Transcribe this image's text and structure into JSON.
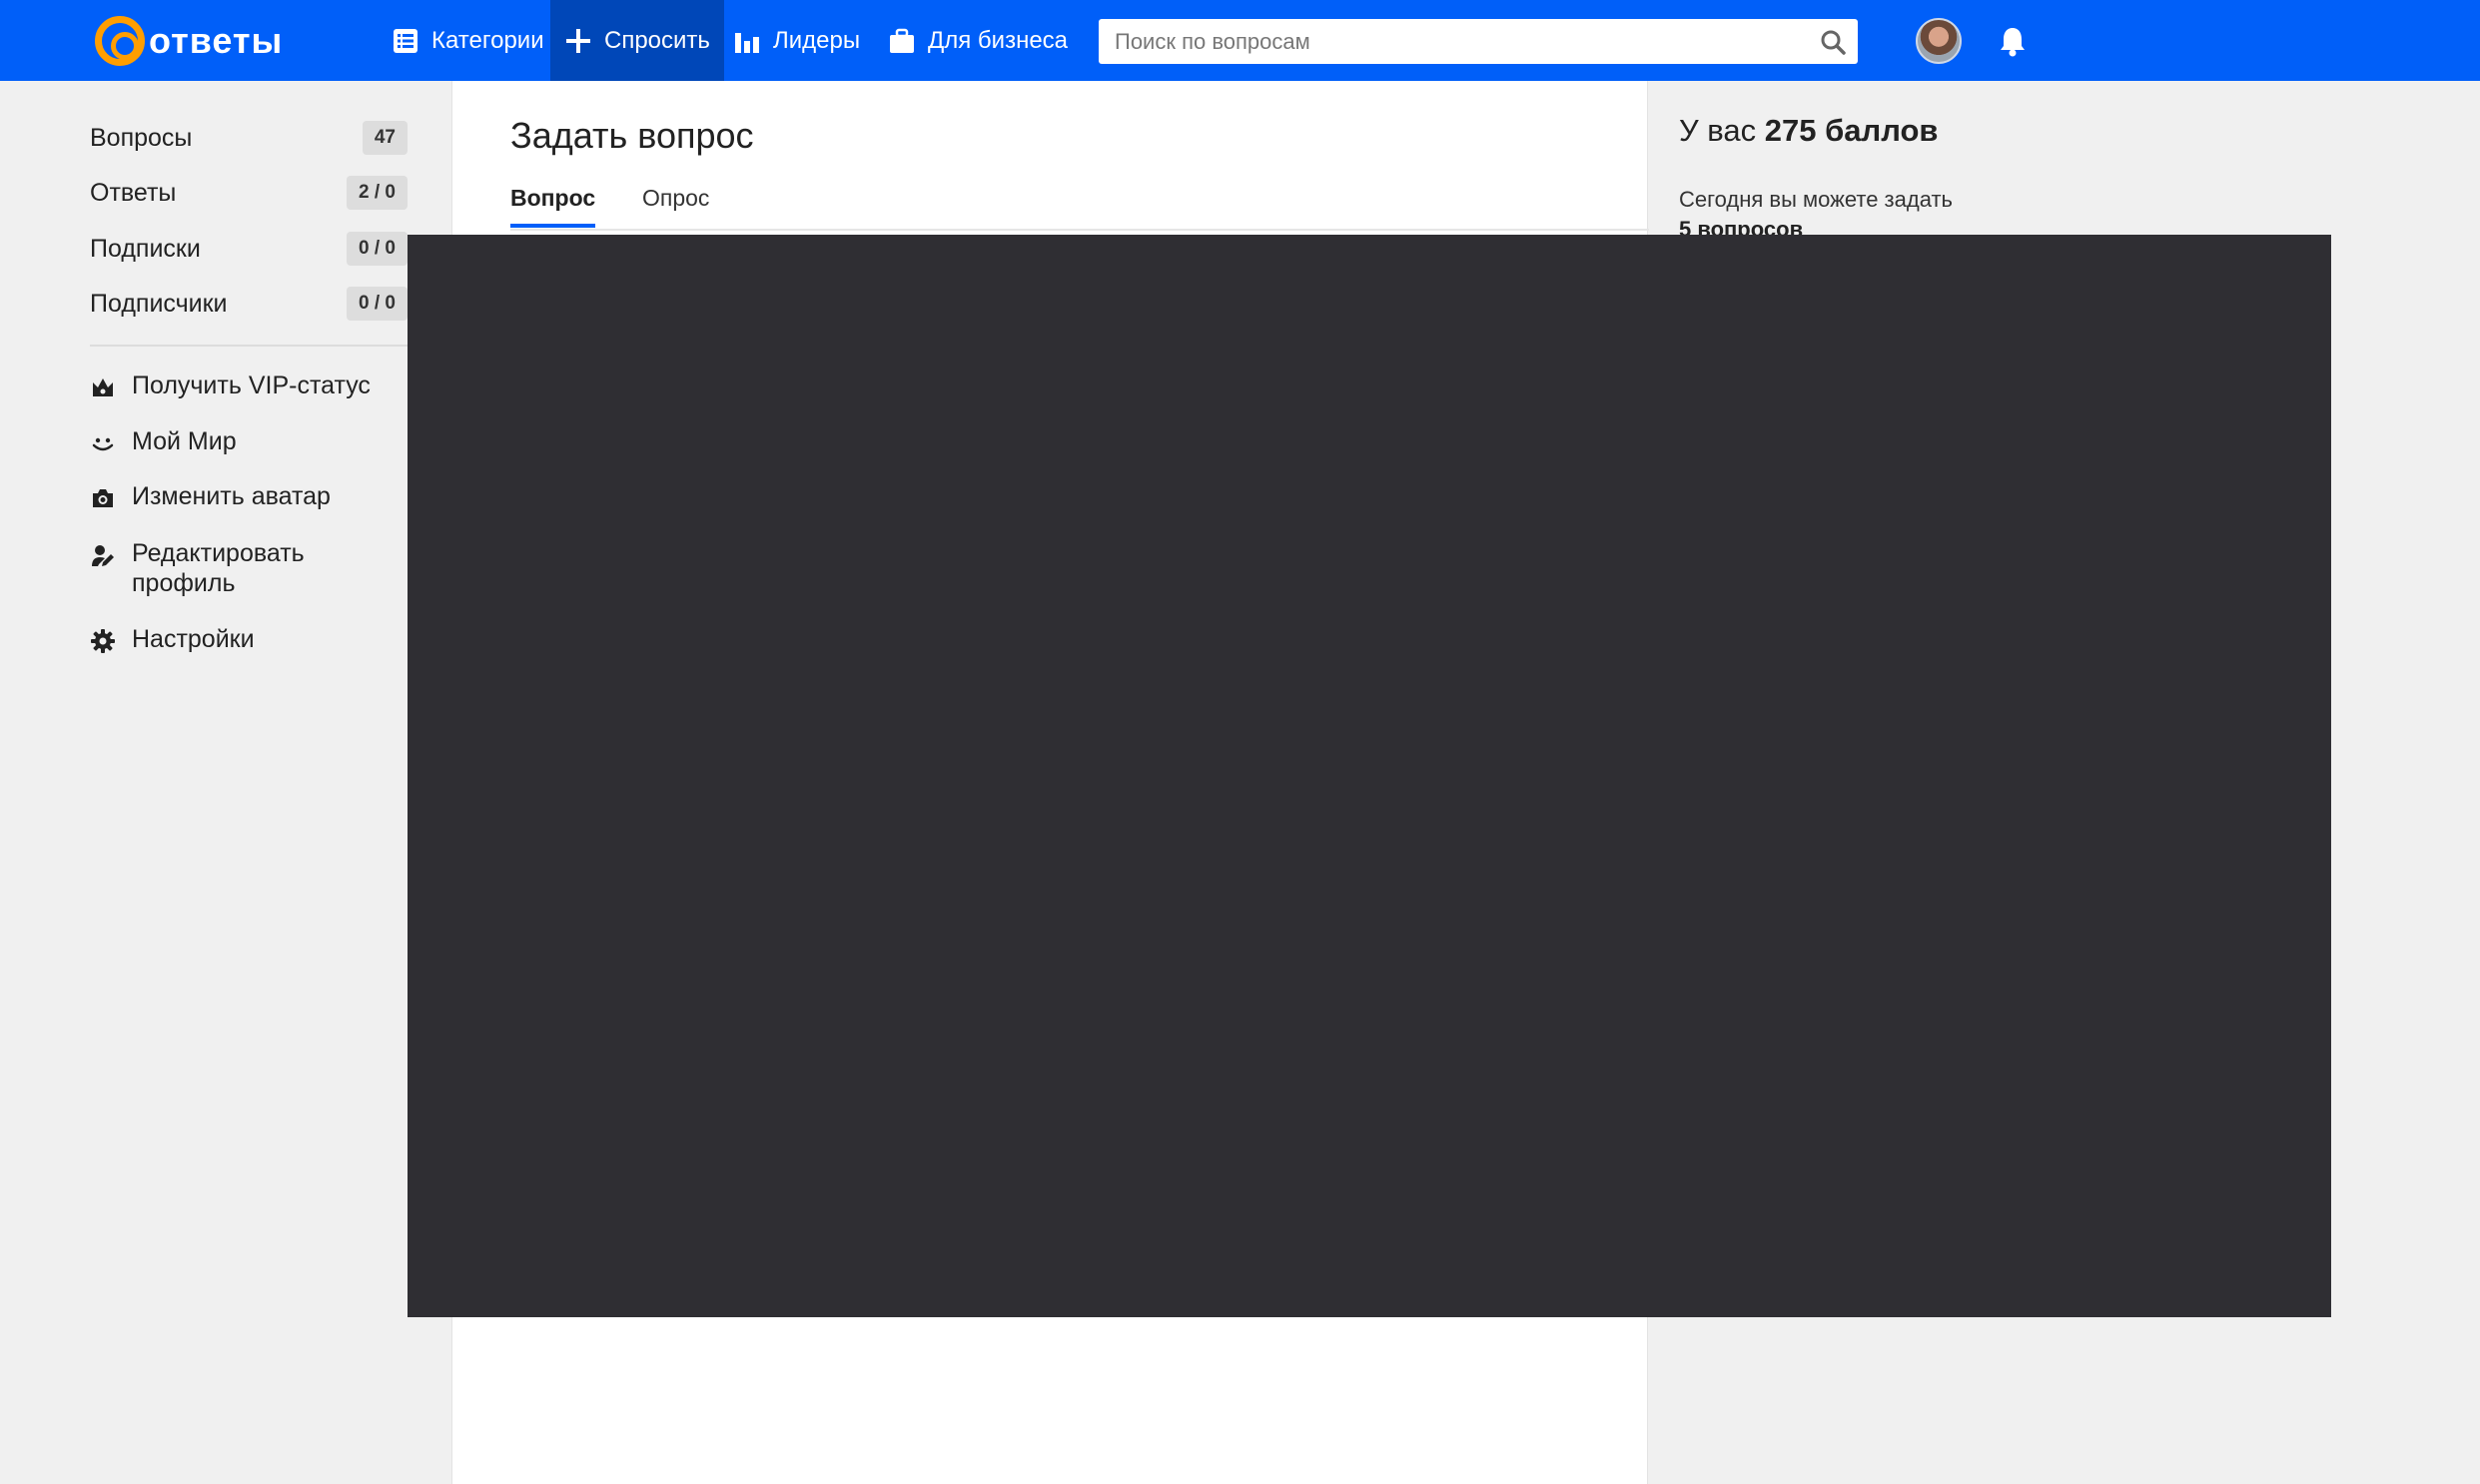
{
  "header": {
    "logo_text": "ответы",
    "nav": [
      {
        "label": "Категории",
        "icon": "list-icon"
      },
      {
        "label": "Спросить",
        "icon": "plus-icon"
      },
      {
        "label": "Лидеры",
        "icon": "bar-chart-icon"
      },
      {
        "label": "Для бизнеса",
        "icon": "briefcase-icon"
      }
    ],
    "search_placeholder": "Поиск по вопросам"
  },
  "sidebar": {
    "stats": [
      {
        "label": "Вопросы",
        "count": "47"
      },
      {
        "label": "Ответы",
        "count": "2 / 0"
      },
      {
        "label": "Подписки",
        "count": "0 / 0"
      },
      {
        "label": "Подписчики",
        "count": "0 / 0"
      }
    ],
    "menu": [
      {
        "label": "Получить VIP-статус",
        "icon": "crown-icon"
      },
      {
        "label": "Мой Мир",
        "icon": "my-world-icon"
      },
      {
        "label": "Изменить аватар",
        "icon": "camera-icon"
      },
      {
        "label": "Редактировать профиль",
        "icon": "edit-profile-icon"
      },
      {
        "label": "Настройки",
        "icon": "gear-icon"
      }
    ]
  },
  "main": {
    "title": "Задать вопрос",
    "tabs": [
      {
        "label": "Вопрос",
        "active": true
      },
      {
        "label": "Опрос",
        "active": false
      }
    ]
  },
  "right": {
    "points_prefix": "У вас",
    "points_value": "275 баллов",
    "today_text": "Сегодня вы можете задать",
    "today_value": "5 вопросов"
  },
  "colors": {
    "brand_blue": "#005ff9",
    "active_nav": "#0047b8",
    "logo_orange": "#ff9e00",
    "overlay": "#2f2e33"
  }
}
